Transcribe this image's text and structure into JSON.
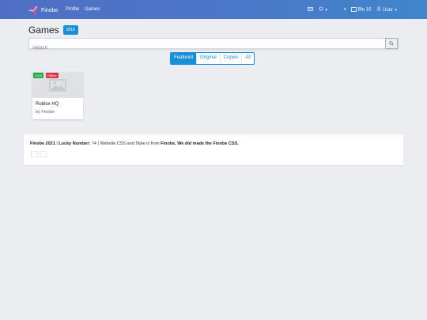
{
  "nav": {
    "brand": "Finobe",
    "links": [
      "Profile",
      "Games"
    ],
    "right": {
      "mail_icon": "mail-icon",
      "bell_icon": "bell-icon",
      "currency_label": "Blu 10",
      "user_label": "User"
    }
  },
  "page": {
    "title": "Games",
    "year_badge": "2016",
    "search_placeholder": "Search"
  },
  "tabs": [
    {
      "label": "Featured",
      "active": true
    },
    {
      "label": "Original",
      "active": false
    },
    {
      "label": "Copies",
      "active": false
    },
    {
      "label": "All",
      "active": false
    }
  ],
  "game": {
    "badge_year": "2016",
    "badge_status": "Offline",
    "title": "Roblox HQ",
    "author": "by Finobe"
  },
  "footer": {
    "brand_year": "Finobe 2021",
    "lucky_label": "Lucky Number:",
    "lucky_value": "74",
    "text1": "| Website CSS and Style is from",
    "bold1": "Finobe",
    "bold2": "We did made the Finobe CSS."
  },
  "colors": {
    "nav": "#4f6fc5",
    "accent": "#1a8fd8",
    "success": "#28a745",
    "danger": "#dc3545",
    "background": "#ecedf1"
  }
}
